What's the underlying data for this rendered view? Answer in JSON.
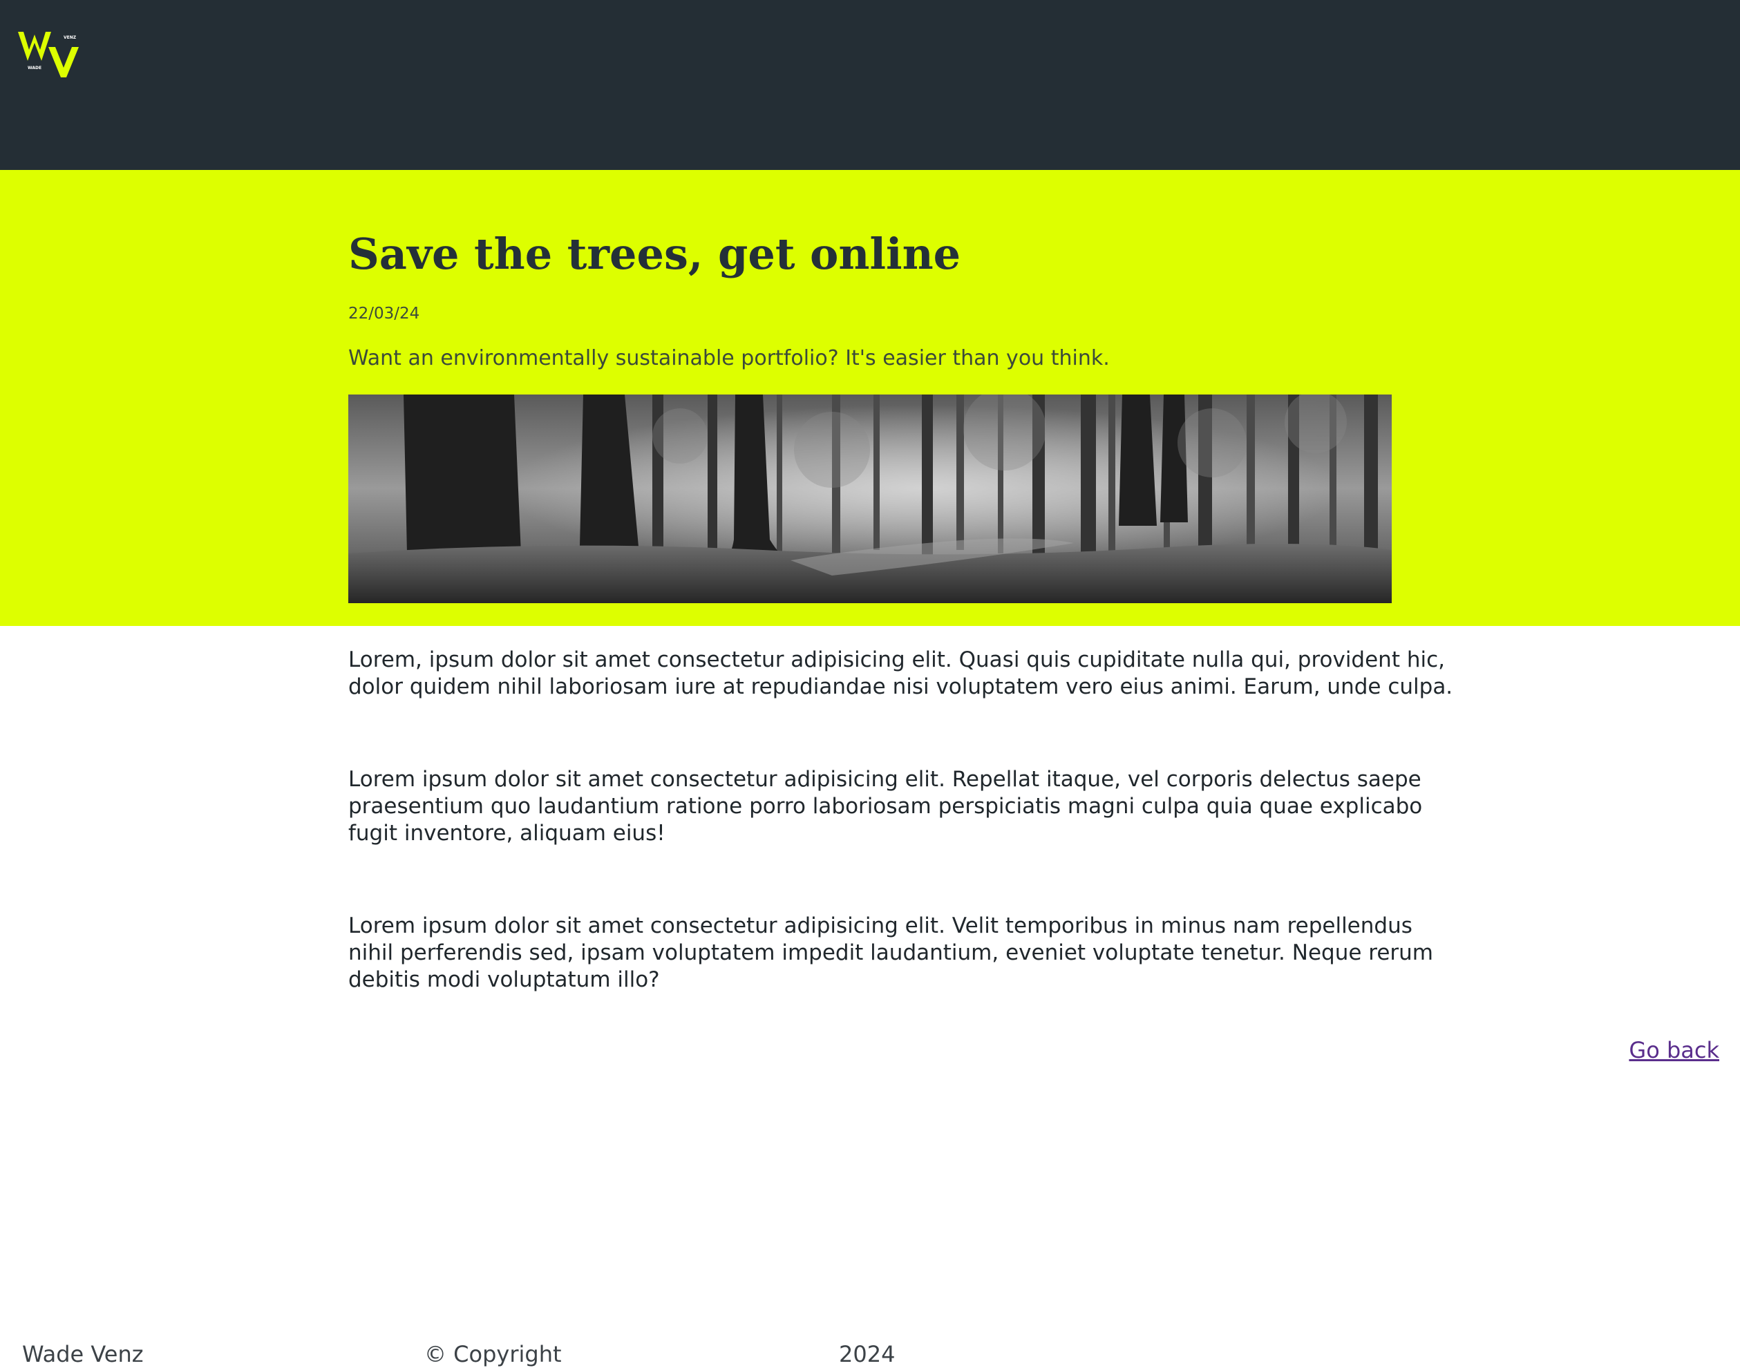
{
  "header": {
    "logo": {
      "text_main": "WV",
      "text_small_top": "VENZ",
      "text_small_bottom": "WADE",
      "color": "#ddff00"
    }
  },
  "article": {
    "title": "Save the trees, get online",
    "date": "22/03/24",
    "subtitle": "Want an environmentally sustainable portfolio? It's easier than you think.",
    "image_subject": "grayscale forest with tall tree trunks",
    "paragraphs": [
      "Lorem, ipsum dolor sit amet consectetur adipisicing elit. Quasi quis cupiditate nulla qui, provident hic, dolor quidem nihil laboriosam iure at repudiandae nisi voluptatem vero eius animi. Earum, unde culpa.",
      "Lorem ipsum dolor sit amet consectetur adipisicing elit. Repellat itaque, vel corporis delectus saepe praesentium quo laudantium ratione porro laboriosam perspiciatis magni culpa quia quae explicabo fugit inventore, aliquam eius!",
      "Lorem ipsum dolor sit amet consectetur adipisicing elit. Velit temporibus in minus nam repellendus nihil perferendis sed, ipsam voluptatem impedit laudantium, eveniet voluptate tenetur. Neque rerum debitis modi voluptatum illo?"
    ],
    "go_back": "Go back"
  },
  "footer": {
    "name": "Wade Venz",
    "copyright": "© Copyright",
    "year": "2024"
  },
  "colors": {
    "header_bg": "#242e35",
    "hero_bg": "#ddff00",
    "link": "#5a2e8c"
  }
}
